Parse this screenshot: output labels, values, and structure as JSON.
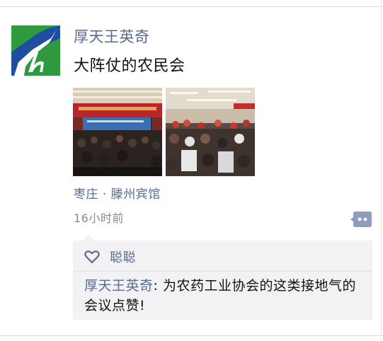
{
  "post": {
    "author": "厚天王英奇",
    "text": "大阵仗的农民会",
    "location": "枣庄 · 滕州宾馆",
    "time": "16小时前"
  },
  "photos": [
    {
      "icon": "conference-photo-1"
    },
    {
      "icon": "conference-photo-2"
    }
  ],
  "likes": {
    "icon": "heart-outline-icon",
    "names": "聪聪"
  },
  "comments": [
    {
      "author": "厚天王英奇",
      "separator": ": ",
      "text": "为农药工业协会的这类接地气的会议点赞!"
    }
  ],
  "colors": {
    "name_link": "#5a6a92",
    "panel_bg": "#f2f2f4",
    "avatar_green": "#2e9a3e",
    "avatar_blue": "#1f4ea1"
  }
}
